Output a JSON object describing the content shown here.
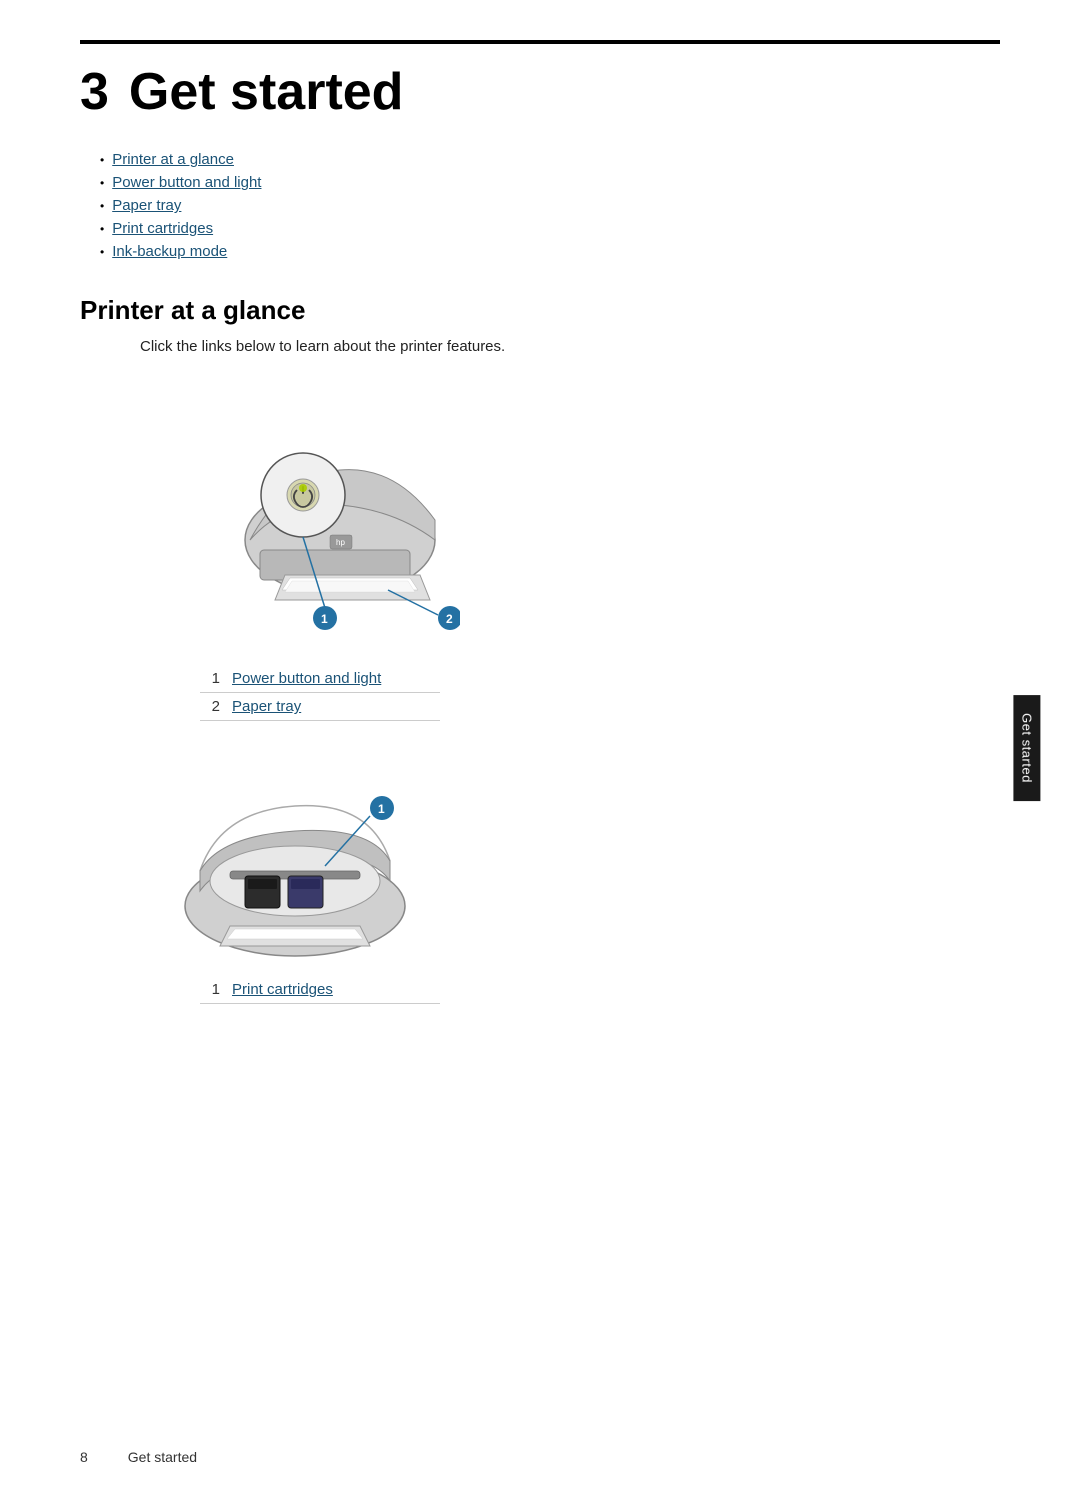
{
  "chapter": {
    "number": "3",
    "title": "Get started"
  },
  "toc": {
    "items": [
      {
        "label": "Printer at a glance",
        "href": "#printer-at-a-glance"
      },
      {
        "label": "Power button and light",
        "href": "#power-button"
      },
      {
        "label": "Paper tray",
        "href": "#paper-tray"
      },
      {
        "label": "Print cartridges",
        "href": "#print-cartridges"
      },
      {
        "label": "Ink-backup mode",
        "href": "#ink-backup"
      }
    ]
  },
  "section": {
    "title": "Printer at a glance",
    "intro": "Click the links below to learn about the printer features."
  },
  "diagram1": {
    "callouts": [
      {
        "number": "1",
        "label": "Power button and light",
        "href": "#power-button"
      },
      {
        "number": "2",
        "label": "Paper tray",
        "href": "#paper-tray"
      }
    ]
  },
  "diagram2": {
    "callouts": [
      {
        "number": "1",
        "label": "Print cartridges",
        "href": "#print-cartridges"
      }
    ]
  },
  "footer": {
    "page_number": "8",
    "section_label": "Get started"
  },
  "side_tab": {
    "label": "Get started"
  }
}
